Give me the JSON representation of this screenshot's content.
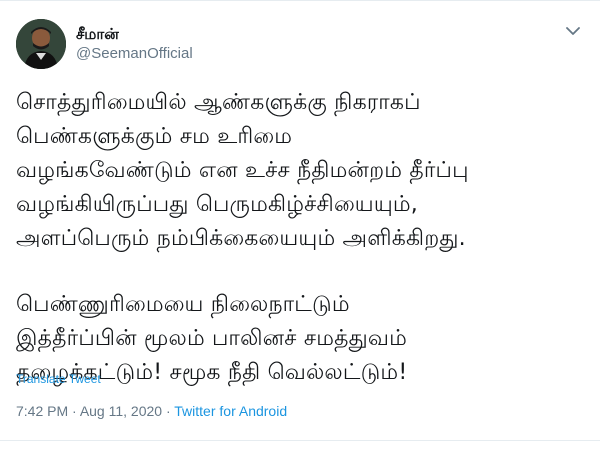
{
  "author": {
    "display_name": "சீமான்",
    "handle": "@SeemanOfficial"
  },
  "tweet": {
    "paragraphs": [
      {
        "lines": [
          "சொத்துரிமையில் ஆண்களுக்கு நிகராகப்",
          "பெண்களுக்கும் சம உரிமை",
          "வழங்கவேண்டும் என உச்ச நீதிமன்றம் தீர்ப்பு",
          "வழங்கியிருப்பது பெருமகிழ்ச்சியையும்,",
          "அளப்பெரும் நம்பிக்கையையும் அளிக்கிறது."
        ]
      },
      {
        "lines": [
          "பெண்ணுரிமையை நிலைநாட்டும்",
          "இத்தீர்ப்பின் மூலம் பாலினச் சமத்துவம்",
          "தழைக்கட்டும்! சமூக நீதி வெல்லட்டும்!"
        ]
      }
    ],
    "translate_label": "Translate Tweet",
    "time": "7:42 PM",
    "separator": " · ",
    "date": "Aug 11, 2020",
    "source": "Twitter for Android"
  },
  "icons": {
    "menu": "chevron-down-icon",
    "avatar": "avatar"
  },
  "colors": {
    "link": "#1b95e0",
    "secondary_text": "#657786",
    "primary_text": "#14171a",
    "divider": "#e6ecf0"
  }
}
